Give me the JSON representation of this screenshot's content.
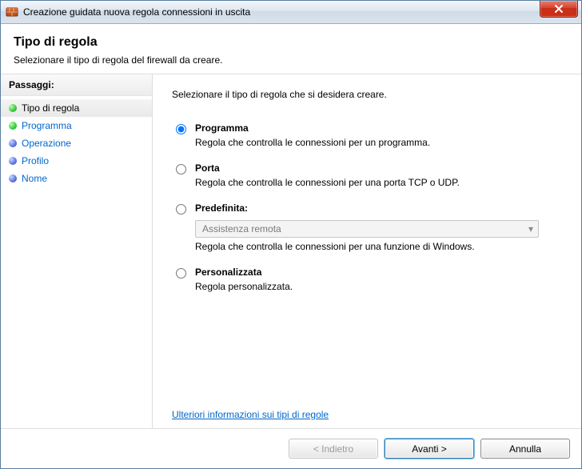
{
  "window": {
    "title": "Creazione guidata nuova regola connessioni in uscita"
  },
  "header": {
    "heading": "Tipo di regola",
    "subtitle": "Selezionare il tipo di regola del firewall da creare."
  },
  "sidebar": {
    "heading": "Passaggi:",
    "steps": [
      {
        "label": "Tipo di regola",
        "bullet": "green",
        "state": "current"
      },
      {
        "label": "Programma",
        "bullet": "green",
        "state": "link"
      },
      {
        "label": "Operazione",
        "bullet": "blue",
        "state": "link"
      },
      {
        "label": "Profilo",
        "bullet": "blue",
        "state": "link"
      },
      {
        "label": "Nome",
        "bullet": "blue",
        "state": "link"
      }
    ]
  },
  "main": {
    "prompt": "Selezionare il tipo di regola che si desidera creare.",
    "options": {
      "programma": {
        "title": "Programma",
        "desc": "Regola che controlla le connessioni per un programma."
      },
      "porta": {
        "title": "Porta",
        "desc": "Regola che controlla le connessioni per una porta TCP o UDP."
      },
      "predefinita": {
        "title": "Predefinita:",
        "selected_value": "Assistenza remota",
        "desc": "Regola che controlla le connessioni per una funzione di Windows."
      },
      "personalizzata": {
        "title": "Personalizzata",
        "desc": "Regola personalizzata."
      }
    },
    "selected_option": "programma",
    "learn_more": "Ulteriori informazioni sui tipi di regole"
  },
  "footer": {
    "back": "< Indietro",
    "next": "Avanti >",
    "cancel": "Annulla"
  }
}
